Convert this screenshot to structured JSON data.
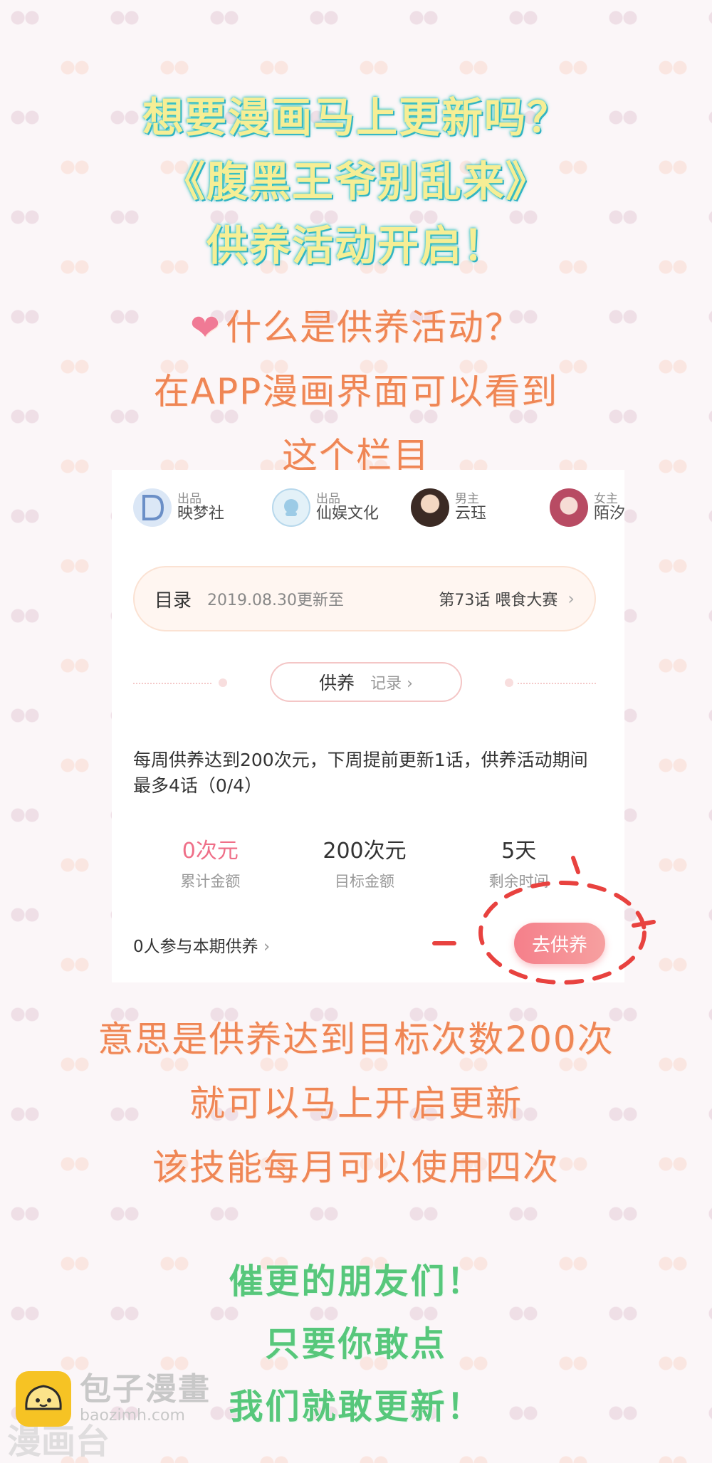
{
  "titles": [
    "想要漫画马上更新吗？",
    "《腹黑王爷别乱来》",
    "供养活动开启！"
  ],
  "intro": {
    "question": "什么是供养活动？",
    "line1": "在APP漫画界面可以看到",
    "line2": "这个栏目"
  },
  "creators": [
    {
      "role": "出品",
      "name": "映梦社",
      "icon": "studio-logo",
      "color": "#8fb3e0"
    },
    {
      "role": "出品",
      "name": "仙娱文化",
      "icon": "studio-logo",
      "color": "#b7d8ec"
    },
    {
      "role": "男主",
      "name": "云珏",
      "icon": "character-avatar",
      "color": "#6d4a3a"
    },
    {
      "role": "女主",
      "name": "陌汐",
      "icon": "character-avatar",
      "color": "#c8627a"
    }
  ],
  "catalog": {
    "label": "目录",
    "date": "2019.08.30更新至",
    "chapter": "第73话 喂食大赛"
  },
  "support": {
    "tab": "供养",
    "record": "记录",
    "description": "每周供养达到200次元，下周提前更新1话，供养活动期间最多4话（0/4）",
    "stats": [
      {
        "value": "0次元",
        "label": "累计金额"
      },
      {
        "value": "200次元",
        "label": "目标金额"
      },
      {
        "value": "5天",
        "label": "剩余时间"
      }
    ],
    "participants": "0人参与本期供养",
    "button": "去供养"
  },
  "explain": [
    "意思是供养达到目标次数200次",
    "就可以马上开启更新",
    "该技能每月可以使用四次"
  ],
  "closing": [
    "催更的朋友们！",
    "只要你敢点",
    "我们就敢更新！"
  ],
  "watermark": {
    "name": "包子漫畫",
    "url": "baozimh.com",
    "under": "漫画台"
  },
  "colors": {
    "accent_pink": "#ef6f88",
    "button_gradient_start": "#f57f8a",
    "orange_text": "#ef8655",
    "green_text": "#57c77b",
    "logo_yellow": "#f6c324"
  }
}
